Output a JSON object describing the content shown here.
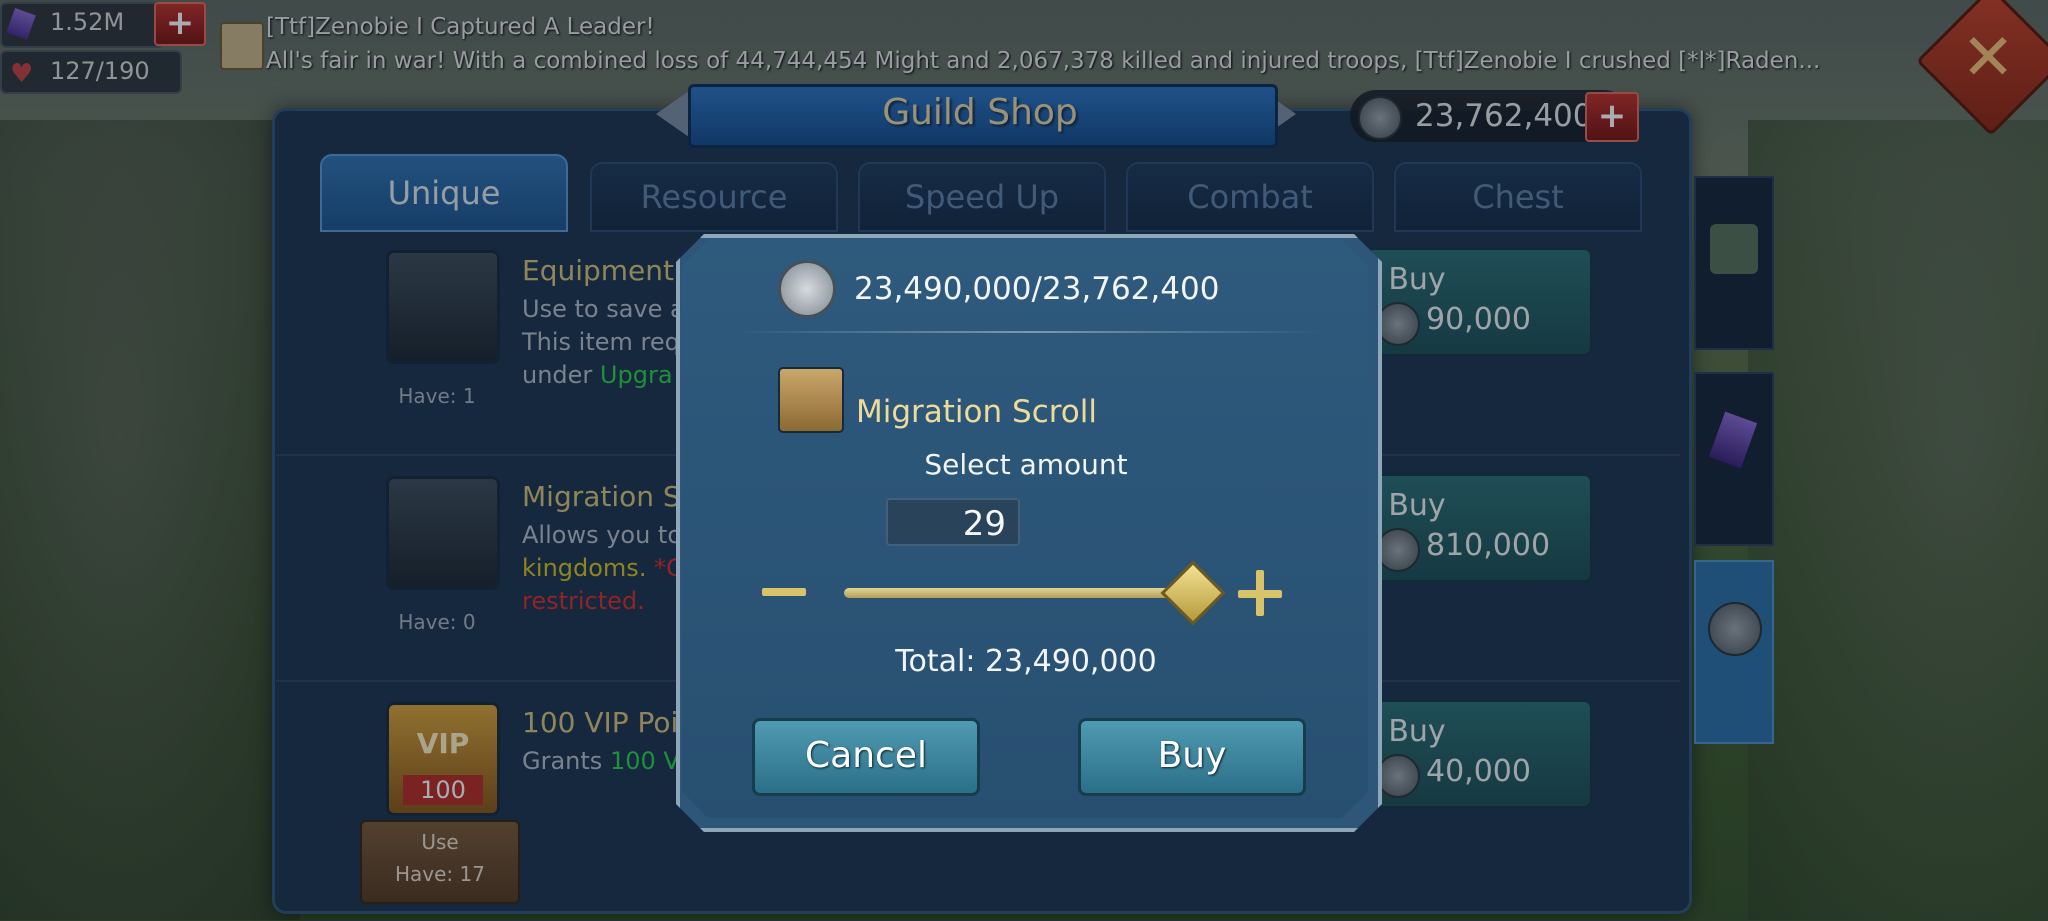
{
  "hud": {
    "gems": "1.52M",
    "health": "127/190"
  },
  "news": {
    "title": "[Ttf]Zenobie I Captured A Leader!",
    "body": "All's fair in war! With a combined loss of 44,744,454 Might and 2,067,378 killed and injured troops, [Ttf]Zenobie I crushed [*l*]Raden..."
  },
  "shop": {
    "title": "Guild Shop",
    "currency": "23,762,400",
    "tabs": [
      "Unique",
      "Resource",
      "Speed Up",
      "Combat",
      "Chest"
    ],
    "active_tab": "Unique",
    "items": [
      {
        "name": "Equipment",
        "desc_line1": "Use to save a",
        "desc_line2": "This item req",
        "desc_line3_prefix": "under ",
        "desc_line3_highlight": "Upgra",
        "have": "Have: 1",
        "buy_label": "Buy",
        "price": "90,000"
      },
      {
        "name": "Migration S",
        "desc_line1": "Allows you to",
        "desc_line2_highlight": "kingdoms. ",
        "desc_line2_red": "*C",
        "desc_line3_red": "restricted.",
        "have": "Have: 0",
        "buy_label": "Buy",
        "price": "810,000"
      },
      {
        "name": "100 VIP Poi",
        "desc_prefix": "Grants ",
        "desc_highlight": "100 V",
        "vip_badge": "VIP",
        "vip_number": "100",
        "use_label": "Use",
        "have": "Have: 17",
        "buy_label": "Buy",
        "price": "40,000"
      }
    ]
  },
  "modal": {
    "balance": "23,490,000/23,762,400",
    "item_name": "Migration Scroll",
    "select_label": "Select amount",
    "amount": "29",
    "slider_fraction": 1.0,
    "total": "Total: 23,490,000",
    "cancel_label": "Cancel",
    "buy_label": "Buy"
  },
  "colors": {
    "accent_gold": "#d7c47b",
    "highlight_green": "#2cd34a",
    "highlight_red": "#d7302a",
    "button_teal": "#2b6f88"
  }
}
